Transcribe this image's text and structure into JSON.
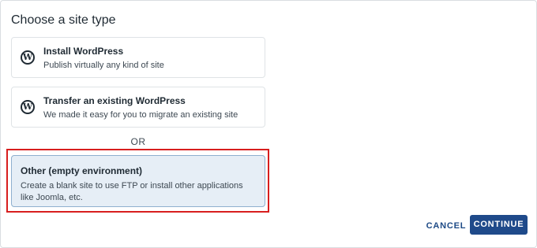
{
  "page": {
    "title": "Choose a site type"
  },
  "options": [
    {
      "title": "Install WordPress",
      "description": "Publish virtually any kind of site",
      "icon": "wordpress-icon"
    },
    {
      "title": "Transfer an existing WordPress",
      "description": "We made it easy for you to migrate an existing site",
      "icon": "wordpress-icon"
    },
    {
      "title": "Other (empty environment)",
      "description": "Create a blank site to use FTP or install other applications like Joomla, etc.",
      "selected": true
    }
  ],
  "separator": "OR",
  "actions": {
    "cancel_label": "CANCEL",
    "continue_label": "CONTINUE"
  },
  "colors": {
    "primary": "#1f4a8a",
    "selected_bg": "#e6eef6",
    "highlight": "#d81e1e"
  }
}
